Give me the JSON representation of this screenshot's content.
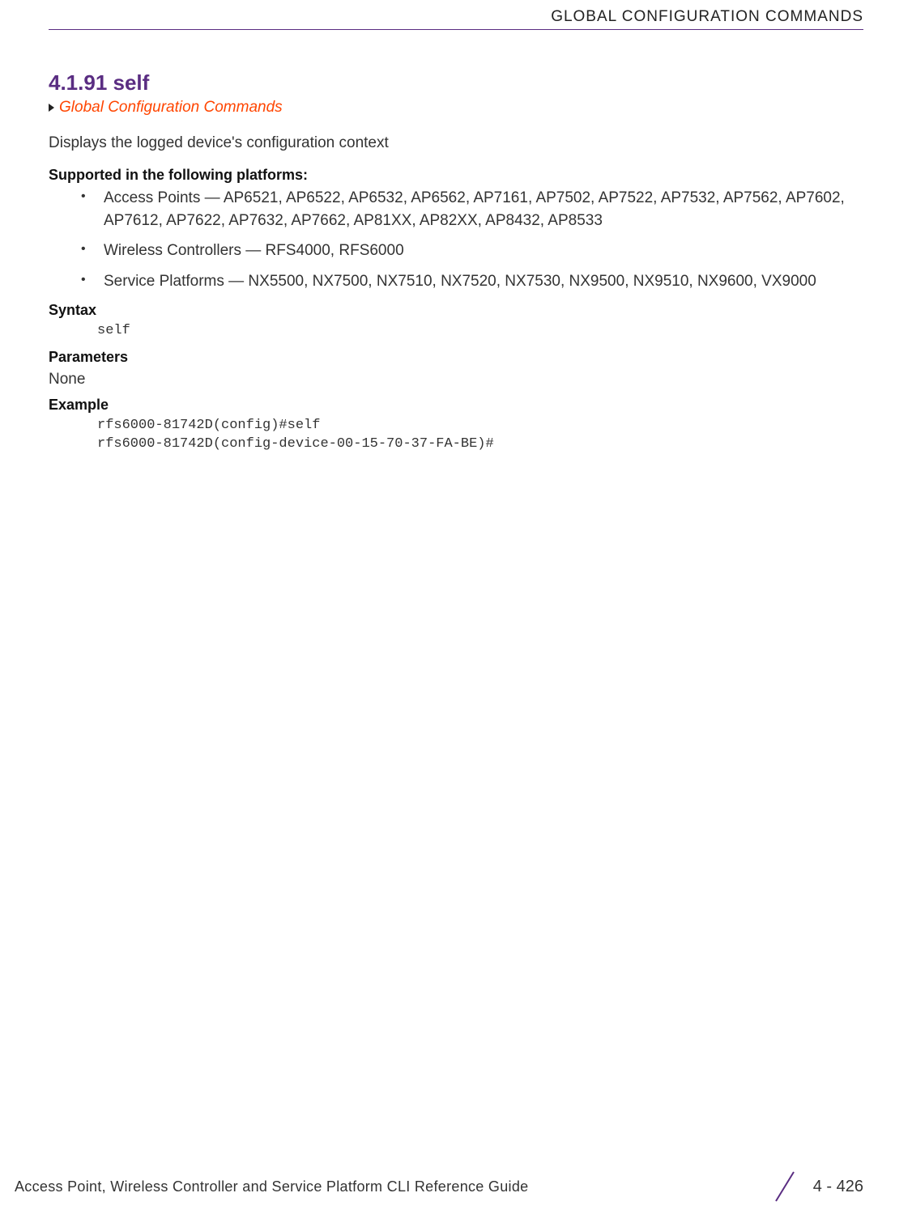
{
  "header": {
    "running": "GLOBAL CONFIGURATION COMMANDS"
  },
  "section": {
    "number_title": "4.1.91 self",
    "breadcrumb": "Global Configuration Commands",
    "intro": "Displays the logged device's configuration context"
  },
  "supported": {
    "heading": "Supported in the following platforms:",
    "items": [
      "Access Points — AP6521, AP6522, AP6532, AP6562, AP7161, AP7502, AP7522, AP7532, AP7562, AP7602, AP7612, AP7622, AP7632, AP7662, AP81XX, AP82XX, AP8432, AP8533",
      "Wireless Controllers — RFS4000, RFS6000",
      "Service Platforms — NX5500, NX7500, NX7510, NX7520, NX7530, NX9500, NX9510, NX9600, VX9000"
    ]
  },
  "syntax": {
    "heading": "Syntax",
    "code": "self"
  },
  "parameters": {
    "heading": "Parameters",
    "value": "None"
  },
  "example": {
    "heading": "Example",
    "code": "rfs6000-81742D(config)#self\nrfs6000-81742D(config-device-00-15-70-37-FA-BE)#"
  },
  "footer": {
    "title": "Access Point, Wireless Controller and Service Platform CLI Reference Guide",
    "page": "4 - 426"
  }
}
